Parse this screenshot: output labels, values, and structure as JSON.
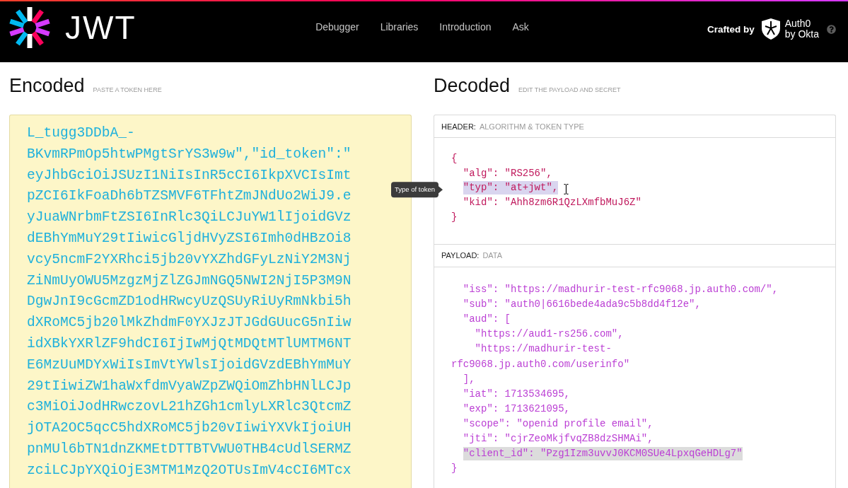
{
  "nav": {
    "logo_text": "JWT",
    "links": [
      "Debugger",
      "Libraries",
      "Introduction",
      "Ask"
    ]
  },
  "credit": {
    "label": "Crafted by",
    "brand_lines": [
      "Auth0",
      "by Okta"
    ]
  },
  "encoded": {
    "title": "Encoded",
    "hint": "PASTE A TOKEN HERE",
    "token_lines": [
      "L_tugg3DDbA_-",
      "BKvmRPmOp5htwPMgtSrYS3w9w\",\"id_token\":\"",
      "eyJhbGciOiJSUzI1NiIsInR5cCI6IkpXVCIsImt",
      "pZCI6IkFoaDh6bTZSMVF6TFhtZmJNdUo2WiJ9.e",
      "yJuaWNrbmFtZSI6InRlc3QiLCJuYW1lIjoidGVz",
      "dEBhYmMuY29tIiwicGljdHVyZSI6Imh0dHBzOi8",
      "vcy5ncmF2YXRhci5jb20vYXZhdGFyLzNiY2M3Nj",
      "ZiNmUyOWU5MzgzMjZlZGJmNGQ5NWI2NjI5P3M9N",
      "DgwJnI9cGcmZD1odHRwcyUzQSUyRiUyRmNkbi5h",
      "dXRoMC5jb20lMkZhdmF0YXJzJTJGdGUucG5nIiw",
      "idXBkYXRlZF9hdCI6IjIwMjQtMDQtMTlUMTM6NT",
      "E6MzUuMDYxWiIsImVtYWlsIjoidGVzdEBhYmMuY",
      "29tIiwiZW1haWxfdmVyaWZpZWQiOmZhbHNlLCJp",
      "c3MiOiJodHRwczovL21hZGh1cmlyLXRlc3QtcmZ",
      "jOTA2OC5qcC5hdXRoMC5jb20vIiwiYXVkIjoiUH",
      "pnMUl6bTN1dnZKMEtDTTBTVWU0THB4cUdlSERMZ",
      "zciLCJpYXQiOjE3MTM1MzQ2OTUsImV4cCI6MTcx"
    ]
  },
  "decoded": {
    "title": "Decoded",
    "hint": "EDIT THE PAYLOAD AND SECRET",
    "sections": [
      {
        "kind": "header",
        "label": "HEADER:",
        "caption": "ALGORITHM & TOKEN TYPE",
        "lines": [
          {
            "text": "{",
            "highlighted": false
          },
          {
            "text": "  \"alg\": \"RS256\",",
            "highlighted": false
          },
          {
            "text": "  \"typ\": \"at+jwt\",",
            "highlighted": true,
            "tooltip": "Type of token"
          },
          {
            "text": "  \"kid\": \"Ahh8zm6R1QzLXmfbMuJ6Z\"",
            "highlighted": false
          },
          {
            "text": "}",
            "highlighted": false
          }
        ]
      },
      {
        "kind": "payload",
        "label": "PAYLOAD:",
        "caption": "DATA",
        "lines": [
          {
            "text": "  \"iss\": \"https://madhurir-test-rfc9068.jp.auth0.com/\",",
            "highlighted": false
          },
          {
            "text": "  \"sub\": \"auth0|6616bede4ada9c5b8dd4f12e\",",
            "highlighted": false
          },
          {
            "text": "  \"aud\": [",
            "highlighted": false
          },
          {
            "text": "    \"https://aud1-rs256.com\",",
            "highlighted": false
          },
          {
            "text": "    \"https://madhurir-test-",
            "highlighted": false
          },
          {
            "text": "rfc9068.jp.auth0.com/userinfo\"",
            "highlighted": false
          },
          {
            "text": "  ],",
            "highlighted": false
          },
          {
            "text": "  \"iat\": 1713534695,",
            "highlighted": false
          },
          {
            "text": "  \"exp\": 1713621095,",
            "highlighted": false
          },
          {
            "text": "  \"scope\": \"openid profile email\",",
            "highlighted": false
          },
          {
            "text": "  \"jti\": \"cjrZeoMkjfvqZB8dzSHMAi\",",
            "highlighted": false
          },
          {
            "text": "  \"client_id\": \"Pzg1Izm3uvvJ0KCM0SUe4LpxqGeHDLg7\"",
            "highlighted": true
          },
          {
            "text": "}",
            "highlighted": false
          }
        ]
      }
    ]
  }
}
